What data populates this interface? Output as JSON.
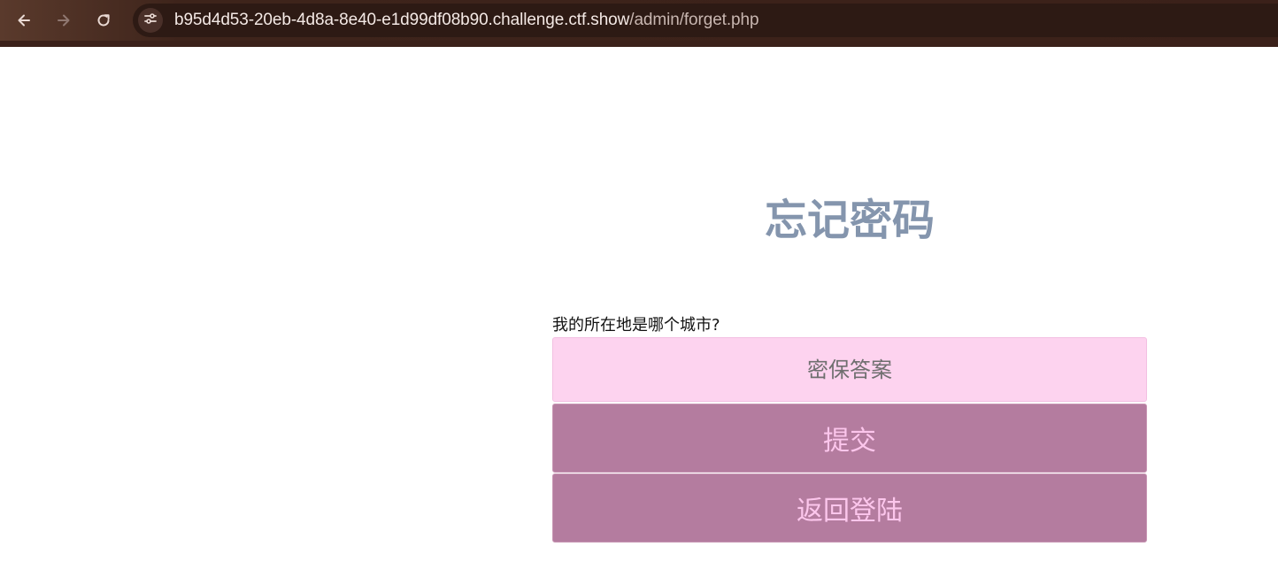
{
  "browser": {
    "url_host": "b95d4d53-20eb-4d8a-8e40-e1d99df08b90.challenge.ctf.show",
    "url_path": "/admin/forget.php",
    "back_icon": "arrow-left-icon",
    "forward_icon": "arrow-right-icon",
    "reload_icon": "reload-icon",
    "site_info_icon": "tune-icon",
    "colors": {
      "toolbar": "#3b211a",
      "omnibox": "#2d1a14",
      "url_text": "#f4e9e5"
    }
  },
  "page": {
    "title": "忘记密码",
    "question": "我的所在地是哪个城市?",
    "answer_placeholder": "密保答案",
    "answer_value": "",
    "submit_label": "提交",
    "back_label": "返回登陆",
    "colors": {
      "title": "#8495ad",
      "input_bg": "#fdd3ef",
      "button_bg": "#b47c9f",
      "button_text": "#fcc6ec"
    }
  }
}
